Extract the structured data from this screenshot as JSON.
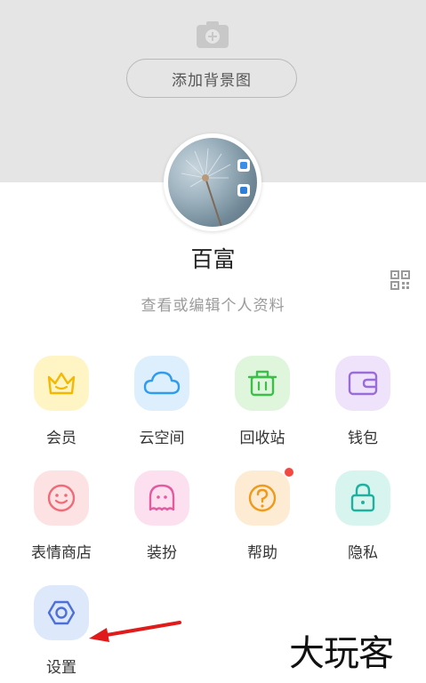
{
  "header": {
    "camera_icon": "camera-plus-icon",
    "add_background_label": "添加背景图"
  },
  "profile": {
    "avatar_icon": "avatar",
    "name": "百富",
    "qr_icon": "qr-code-icon",
    "subtitle": "查看或编辑个人资料"
  },
  "menu": {
    "items": [
      {
        "label": "会员",
        "icon": "crown-icon",
        "color": "#f5b800"
      },
      {
        "label": "云空间",
        "icon": "cloud-icon",
        "color": "#2f9cf0"
      },
      {
        "label": "回收站",
        "icon": "trash-icon",
        "color": "#3cbf4a"
      },
      {
        "label": "钱包",
        "icon": "wallet-icon",
        "color": "#9b6bd8"
      },
      {
        "label": "表情商店",
        "icon": "smiley-icon",
        "color": "#ef6b78"
      },
      {
        "label": "装扮",
        "icon": "ghost-icon",
        "color": "#e25aa0"
      },
      {
        "label": "帮助",
        "icon": "help-icon",
        "color": "#f09a1c",
        "badge": true
      },
      {
        "label": "隐私",
        "icon": "lock-icon",
        "color": "#1fb1a0"
      },
      {
        "label": "设置",
        "icon": "settings-icon",
        "color": "#4d6fd8"
      }
    ]
  },
  "annotation": {
    "arrow_color": "#e01b1b"
  },
  "watermark": {
    "text": "大玩客"
  }
}
